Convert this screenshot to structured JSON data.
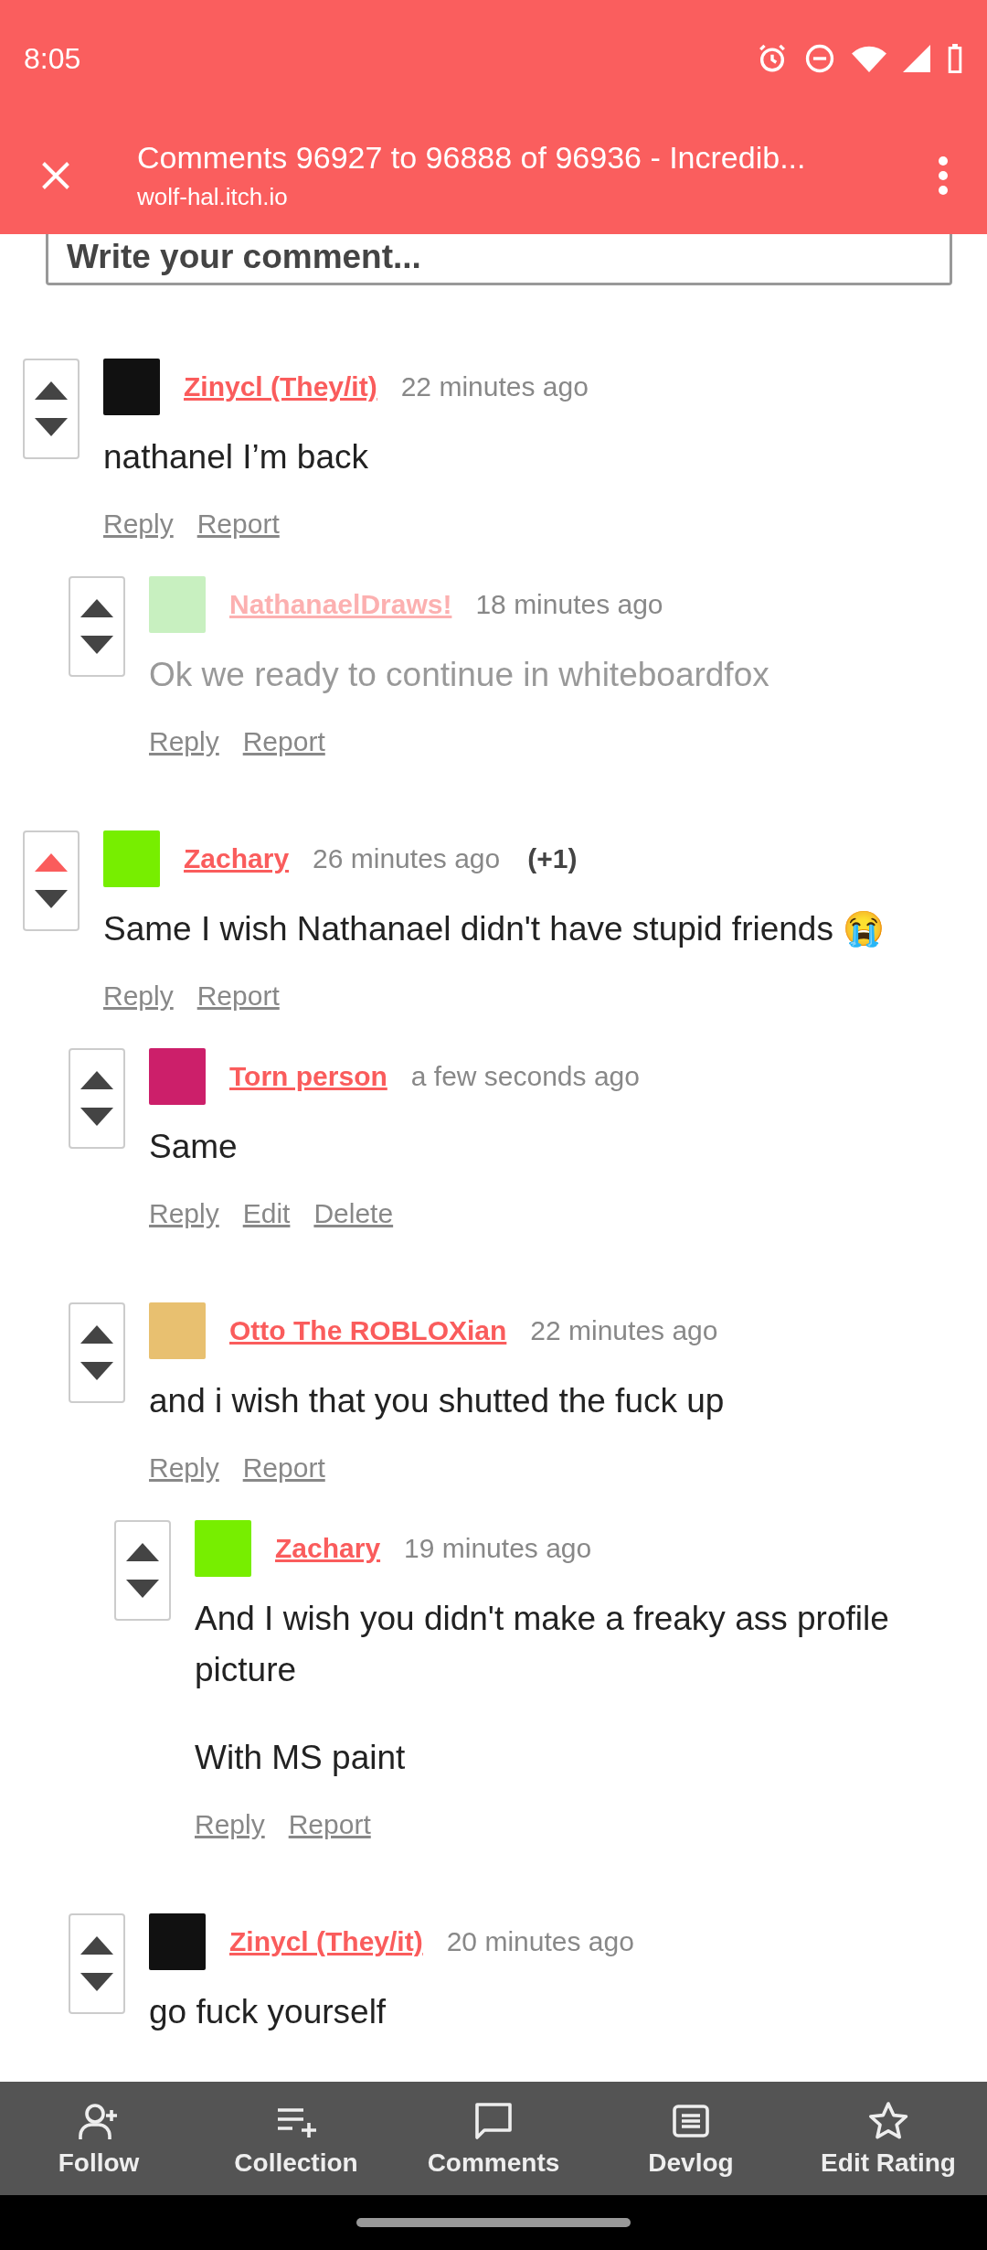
{
  "status_bar": {
    "time": "8:05"
  },
  "toolbar": {
    "title": "Comments 96927 to 96888 of 96936 - Incredib...",
    "url": "wolf-hal.itch.io"
  },
  "comment_field": {
    "placeholder": "Write your comment..."
  },
  "comments": [
    {
      "author": "Zinycl (They/it)",
      "time": "22 minutes ago",
      "upvoted": false,
      "dimmed": false,
      "avatar": {
        "color": "#111111"
      },
      "body": [
        "nathanel I’m back"
      ],
      "actions": [
        "Reply",
        "Report"
      ],
      "children": [
        {
          "author": "NathanaelDraws!",
          "time": "18 minutes ago",
          "upvoted": false,
          "dimmed": true,
          "avatar": {
            "color": "#c8f0c0"
          },
          "body": [
            "Ok we ready to continue in whiteboardfox"
          ],
          "actions": [
            "Reply",
            "Report"
          ]
        }
      ]
    },
    {
      "author": "Zachary",
      "time": "26 minutes ago",
      "score": "(+1)",
      "upvoted": true,
      "dimmed": false,
      "avatar": {
        "color": "#77ee00"
      },
      "body": [
        "Same I wish Nathanael didn't have stupid friends 😭"
      ],
      "actions": [
        "Reply",
        "Report"
      ],
      "children": [
        {
          "author": "Torn person",
          "time": "a few seconds ago",
          "upvoted": false,
          "dimmed": false,
          "avatar": {
            "color": "#cc1f6a"
          },
          "body": [
            "Same"
          ],
          "actions": [
            "Reply",
            "Edit",
            "Delete"
          ]
        },
        {
          "author": "Otto The ROBLOXian",
          "time": "22 minutes ago",
          "upvoted": false,
          "dimmed": false,
          "avatar": {
            "color": "#e8c070"
          },
          "body": [
            "and i wish that you shutted the fuck up"
          ],
          "actions": [
            "Reply",
            "Report"
          ],
          "children": [
            {
              "author": "Zachary",
              "time": "19 minutes ago",
              "upvoted": false,
              "dimmed": false,
              "avatar": {
                "color": "#77ee00"
              },
              "body": [
                "And I wish you didn't make a freaky ass profile picture",
                "With MS paint"
              ],
              "actions": [
                "Reply",
                "Report"
              ]
            }
          ]
        },
        {
          "author": "Zinycl (They/it)",
          "time": "20 minutes ago",
          "upvoted": false,
          "dimmed": false,
          "avatar": {
            "color": "#111111"
          },
          "body": [
            "go fuck yourself"
          ]
        }
      ]
    }
  ],
  "bottom_nav": [
    {
      "label": "Follow"
    },
    {
      "label": "Collection"
    },
    {
      "label": "Comments"
    },
    {
      "label": "Devlog"
    },
    {
      "label": "Edit Rating"
    }
  ]
}
